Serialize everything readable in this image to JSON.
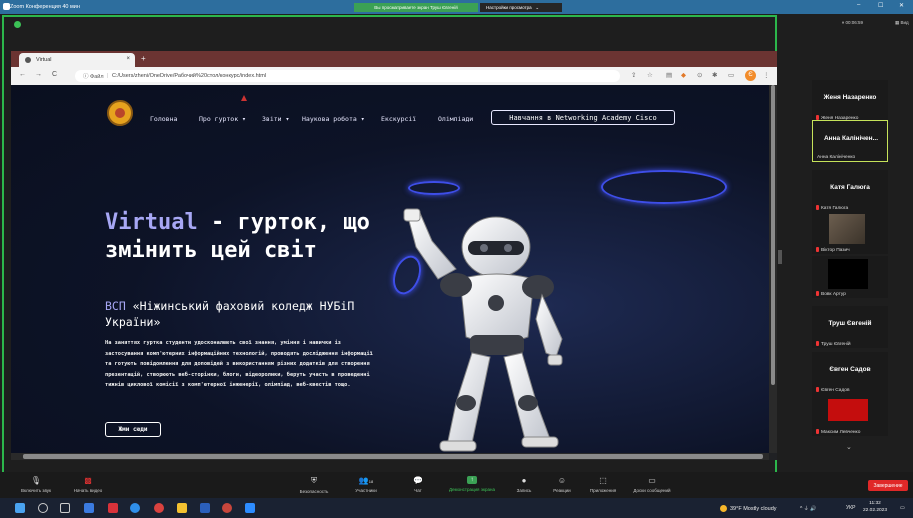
{
  "zoom": {
    "window_title": "Zoom Конференция  40 мин",
    "share_banner": "Вы просматриваете экран Труш Євгеній",
    "view_options": "Настройки просмотра",
    "view_options_chevron": "⌄",
    "timer": "⏸ 00:06:59",
    "view_label": "▦ Вид",
    "win_minimize": "–",
    "win_maximize": "☐",
    "win_close": "✕"
  },
  "browser": {
    "tab_title": "Virtual",
    "tab_close": "×",
    "new_tab": "+",
    "back": "←",
    "forward": "→",
    "reload": "C",
    "url_label": "ⓘ Файл",
    "url": "C:/Users/zheni/OneDrive/Рабочий%20стол/конкурс/index.html",
    "avatar_letter": "Є",
    "menu": "⋮",
    "toolbar_icons": [
      "⇪",
      "☆",
      "▤",
      "◆",
      "⊙",
      "✱",
      "▭"
    ]
  },
  "site": {
    "nav": [
      {
        "label": "Головна"
      },
      {
        "label": "Про гурток ▾"
      },
      {
        "label": "Звіти ▾"
      },
      {
        "label": "Наукова робота ▾"
      },
      {
        "label": "Екскурсії"
      },
      {
        "label": "Олімпіади"
      }
    ],
    "cta": "Навчання в Networking Academy Cisco",
    "hero_accent": "Virtual",
    "hero_rest": " - гурток, що змінить цей світ",
    "sub_accent": "ВСП",
    "sub_rest": " «Ніжинський фаховий коледж НУБіП України»",
    "body": "На заняттях гуртка студенти удосконалюють свої знання, уміння і навички із застосування комп'ютерних інформаційних технологій, проводять дослідження інформації та готують повідомлення для доповідей з використанням різних додатків для створення презентацій, створюють веб-сторінки, блоги, відеоролики, беруть участь в проведенні тижнів циклової комісії з комп'ютерної інженерії, олімпіад, веб-квестів тощо.",
    "button": "Жми сюди"
  },
  "participants": [
    {
      "big": "Женя Назаренко",
      "small": "Женя Назаренко",
      "kind": "name",
      "muted": true
    },
    {
      "big": "Анна Калінічен...",
      "small": "Анна Калініченко",
      "kind": "name",
      "active": true,
      "muted": false
    },
    {
      "big": "Катя Галюга",
      "small": "Катя Галюга",
      "kind": "name",
      "muted": true
    },
    {
      "small": "Віктор Пазич",
      "kind": "video",
      "muted": true
    },
    {
      "small": "Вовк Артур",
      "kind": "black",
      "muted": true
    },
    {
      "big": "Труш Євгеній",
      "small": "Труш Євгеній",
      "kind": "name",
      "muted": true
    },
    {
      "big": "Євген Садов",
      "small": "Євген Садов",
      "kind": "name",
      "muted": true
    },
    {
      "small": "Максим Левченко",
      "kind": "red",
      "muted": true
    }
  ],
  "participants_more": "⌄",
  "toolbar": {
    "mic": "Включить звук",
    "video": "Начать видео",
    "security": "Безопасность",
    "participants": "Участники",
    "participants_count": "18",
    "chat": "Чат",
    "share": "Демонстрация экрана",
    "record": "Запись",
    "reactions": "Реакции",
    "apps": "Приложения",
    "whiteboard": "Доски сообщений",
    "end": "Завершение"
  },
  "taskbar": {
    "weather": "39°F  Mostly cloudy",
    "lang": "УКР",
    "time": "11:32",
    "date": "22.02.2023",
    "tray_icons": "^  ⏚  🔊",
    "notify": "▭"
  },
  "colors": {
    "accent": "#a7a7f4",
    "share_border": "#2cb64b",
    "active_speaker": "#c6e35a",
    "end_button": "#e02828"
  }
}
